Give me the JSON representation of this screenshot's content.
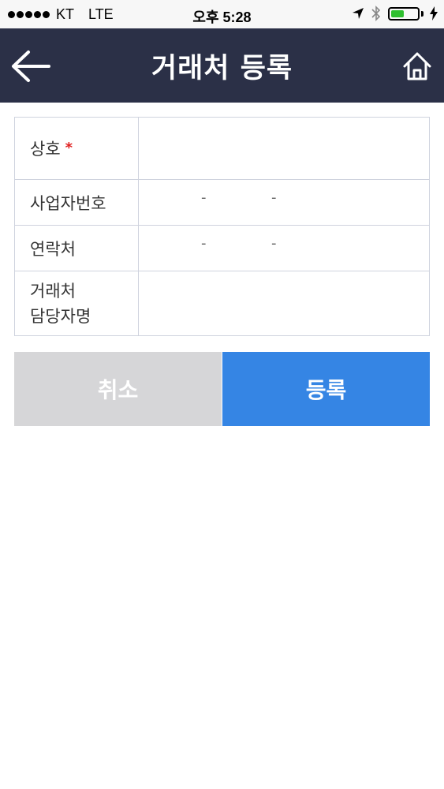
{
  "status_bar": {
    "carrier": "KT",
    "network": "LTE",
    "time": "오후 5:28",
    "battery_percent": 50
  },
  "nav": {
    "title": "거래처 등록",
    "back_icon": "arrow-left-icon",
    "home_icon": "home-icon"
  },
  "form": {
    "rows": [
      {
        "label": "상호",
        "required_mark": "*"
      },
      {
        "label": "사업자번호",
        "separators": [
          "-",
          "-"
        ]
      },
      {
        "label": "연락처",
        "separators": [
          "-",
          "-"
        ]
      },
      {
        "label_line1": "거래처",
        "label_line2": "담당자명"
      }
    ]
  },
  "buttons": {
    "cancel": "취소",
    "register": "등록"
  },
  "colors": {
    "nav_bg": "#2b3047",
    "cancel_bg": "#d6d6d8",
    "register_bg": "#3585e4",
    "required": "#e02020"
  }
}
